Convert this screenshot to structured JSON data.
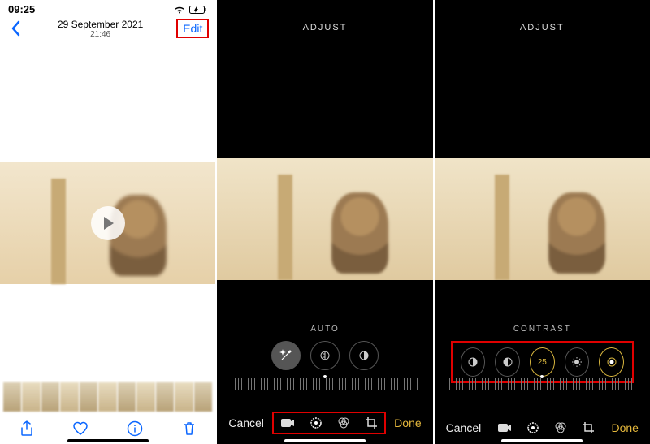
{
  "panel1": {
    "status_time": "09:25",
    "date": "29 September 2021",
    "time": "21:46",
    "edit": "Edit",
    "toolbar": {
      "share": "share-icon",
      "like": "heart-icon",
      "info": "info-icon",
      "delete": "trash-icon"
    }
  },
  "panel2": {
    "header": "ADJUST",
    "mode": "AUTO",
    "cancel": "Cancel",
    "done": "Done",
    "dials": [
      "magic-wand-icon",
      "exposure-icon",
      "contrast-icon"
    ],
    "tools": [
      "video-icon",
      "adjust-icon",
      "filters-icon",
      "crop-icon"
    ]
  },
  "panel3": {
    "header": "ADJUST",
    "mode": "CONTRAST",
    "value": "25",
    "cancel": "Cancel",
    "done": "Done",
    "dials": [
      "brilliance-icon",
      "contrast-icon",
      "value",
      "brightness-icon",
      "black-point-icon"
    ],
    "tools": [
      "video-icon",
      "adjust-icon",
      "filters-icon",
      "crop-icon"
    ]
  }
}
